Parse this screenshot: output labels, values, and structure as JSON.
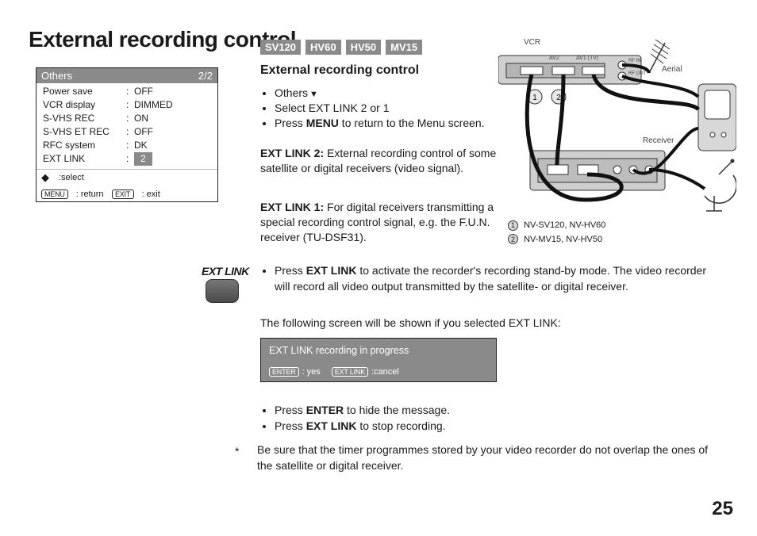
{
  "title": "External recording control",
  "page_number": "25",
  "osd": {
    "header_title": "Others",
    "header_page": "2/2",
    "rows": [
      {
        "label": "Power save",
        "value": "OFF"
      },
      {
        "label": "VCR display",
        "value": "DIMMED"
      },
      {
        "label": "S-VHS REC",
        "value": "ON"
      },
      {
        "label": "S-VHS ET REC",
        "value": "OFF"
      },
      {
        "label": "RFC system",
        "value": "DK"
      },
      {
        "label": "EXT LINK",
        "value": "2"
      }
    ],
    "footer_select": ":select",
    "footer_menu_key": "MENU",
    "footer_menu_text": ": return",
    "footer_exit_key": "EXIT",
    "footer_exit_text": ": exit"
  },
  "badges": [
    "SV120",
    "HV60",
    "HV50",
    "MV15"
  ],
  "section_title": "External recording control",
  "steps": {
    "s1": "Others",
    "s2": "Select EXT LINK 2 or 1",
    "s3_pre": "Press ",
    "s3_menu": "MENU",
    "s3_post": " to return to the Menu screen."
  },
  "extlink2_label": "EXT LINK 2:",
  "extlink2_text": " External recording control of some satellite or digital receivers (video signal).",
  "extlink1_label": "EXT LINK 1:",
  "extlink1_text": " For digital receivers transmitting a special recording control signal, e.g. the F.U.N. receiver (TU-DSF31).",
  "extlink_btn_label": "EXT LINK",
  "para3_pre": "Press ",
  "para3_bold": "EXT LINK",
  "para3_post": " to activate the recorder's recording stand-by mode. The video recorder will record all video output transmitted by the satellite- or digital receiver.",
  "para4": "The following screen will be shown if you selected EXT LINK:",
  "osd2_title": "EXT LINK recording in progress",
  "osd2_enter_key": "ENTER",
  "osd2_enter_text": ": yes",
  "osd2_ext_key": "EXT LINK",
  "osd2_ext_text": ":cancel",
  "bl2a_pre": "Press ",
  "bl2a_bold": "ENTER",
  "bl2a_post": " to hide the message.",
  "bl2b_pre": "Press ",
  "bl2b_bold": "EXT LINK",
  "bl2b_post": " to stop recording.",
  "note_text": "Be sure that the timer programmes stored by your video recorder do not overlap the ones of the satellite or digital receiver.",
  "diagram": {
    "vcr": "VCR",
    "aerial": "Aerial",
    "receiver": "Receiver",
    "port1": "1",
    "port2": "2",
    "av2": "AV2",
    "av1": "AV1 (TV)",
    "rfin": "RF IN",
    "rfout": "RF OUT"
  },
  "legend": {
    "n1": "1",
    "l1": "NV-SV120, NV-HV60",
    "n2": "2",
    "l2": "NV-MV15, NV-HV50"
  }
}
